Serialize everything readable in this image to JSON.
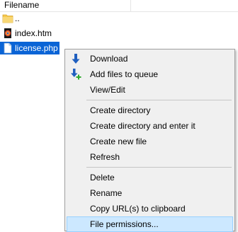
{
  "header": {
    "filename_label": "Filename"
  },
  "files": [
    {
      "name": "..",
      "icon": "folder-icon"
    },
    {
      "name": "index.htm",
      "icon": "html-file-icon"
    },
    {
      "name": "license.php",
      "icon": "php-file-icon"
    }
  ],
  "menu": {
    "download": "Download",
    "add_to_queue": "Add files to queue",
    "view_edit": "View/Edit",
    "create_directory": "Create directory",
    "create_directory_enter": "Create directory and enter it",
    "create_new_file": "Create new file",
    "refresh": "Refresh",
    "delete": "Delete",
    "rename": "Rename",
    "copy_urls": "Copy URL(s) to clipboard",
    "file_permissions": "File permissions..."
  },
  "colors": {
    "selection": "#0a64d6",
    "menu_highlight": "#cce8ff",
    "menu_background": "#f0f0f0"
  }
}
